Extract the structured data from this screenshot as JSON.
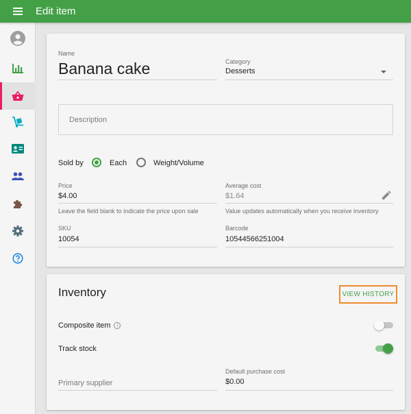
{
  "header": {
    "title": "Edit item"
  },
  "colors": {
    "accent": "#43a047",
    "active": "#e91e63",
    "highlight": "#f08c2d"
  },
  "sidebar": {
    "items": [
      {
        "name": "account-icon",
        "color": "#9e9e9e"
      },
      {
        "name": "reports-icon",
        "color": "#43a047"
      },
      {
        "name": "items-icon",
        "color": "#e91e63",
        "active": true
      },
      {
        "name": "inventory-icon",
        "color": "#00acc1"
      },
      {
        "name": "employees-icon",
        "color": "#00897b"
      },
      {
        "name": "customers-icon",
        "color": "#3f51b5"
      },
      {
        "name": "integrations-icon",
        "color": "#795548"
      },
      {
        "name": "settings-icon",
        "color": "#546e7a"
      },
      {
        "name": "help-icon",
        "color": "#1e88e5"
      }
    ]
  },
  "item": {
    "name_label": "Name",
    "name_value": "Banana cake",
    "category_label": "Category",
    "category_value": "Desserts",
    "description_placeholder": "Description",
    "sold_by_label": "Sold by",
    "sold_by_options": [
      "Each",
      "Weight/Volume"
    ],
    "sold_by_selected": "Each",
    "price_label": "Price",
    "price_value": "$4.00",
    "price_hint": "Leave the field blank to indicate the price upon sale",
    "avg_cost_label": "Average cost",
    "avg_cost_value": "$1.64",
    "avg_cost_hint": "Value updates automatically when you receive inventory",
    "sku_label": "SKU",
    "sku_value": "10054",
    "barcode_label": "Barcode",
    "barcode_value": "10544566251004"
  },
  "inventory": {
    "title": "Inventory",
    "view_history_label": "VIEW HISTORY",
    "composite_label": "Composite item",
    "composite_on": false,
    "track_stock_label": "Track stock",
    "track_stock_on": true,
    "supplier_placeholder": "Primary supplier",
    "purchase_cost_label": "Default purchase cost",
    "purchase_cost_value": "$0.00"
  }
}
